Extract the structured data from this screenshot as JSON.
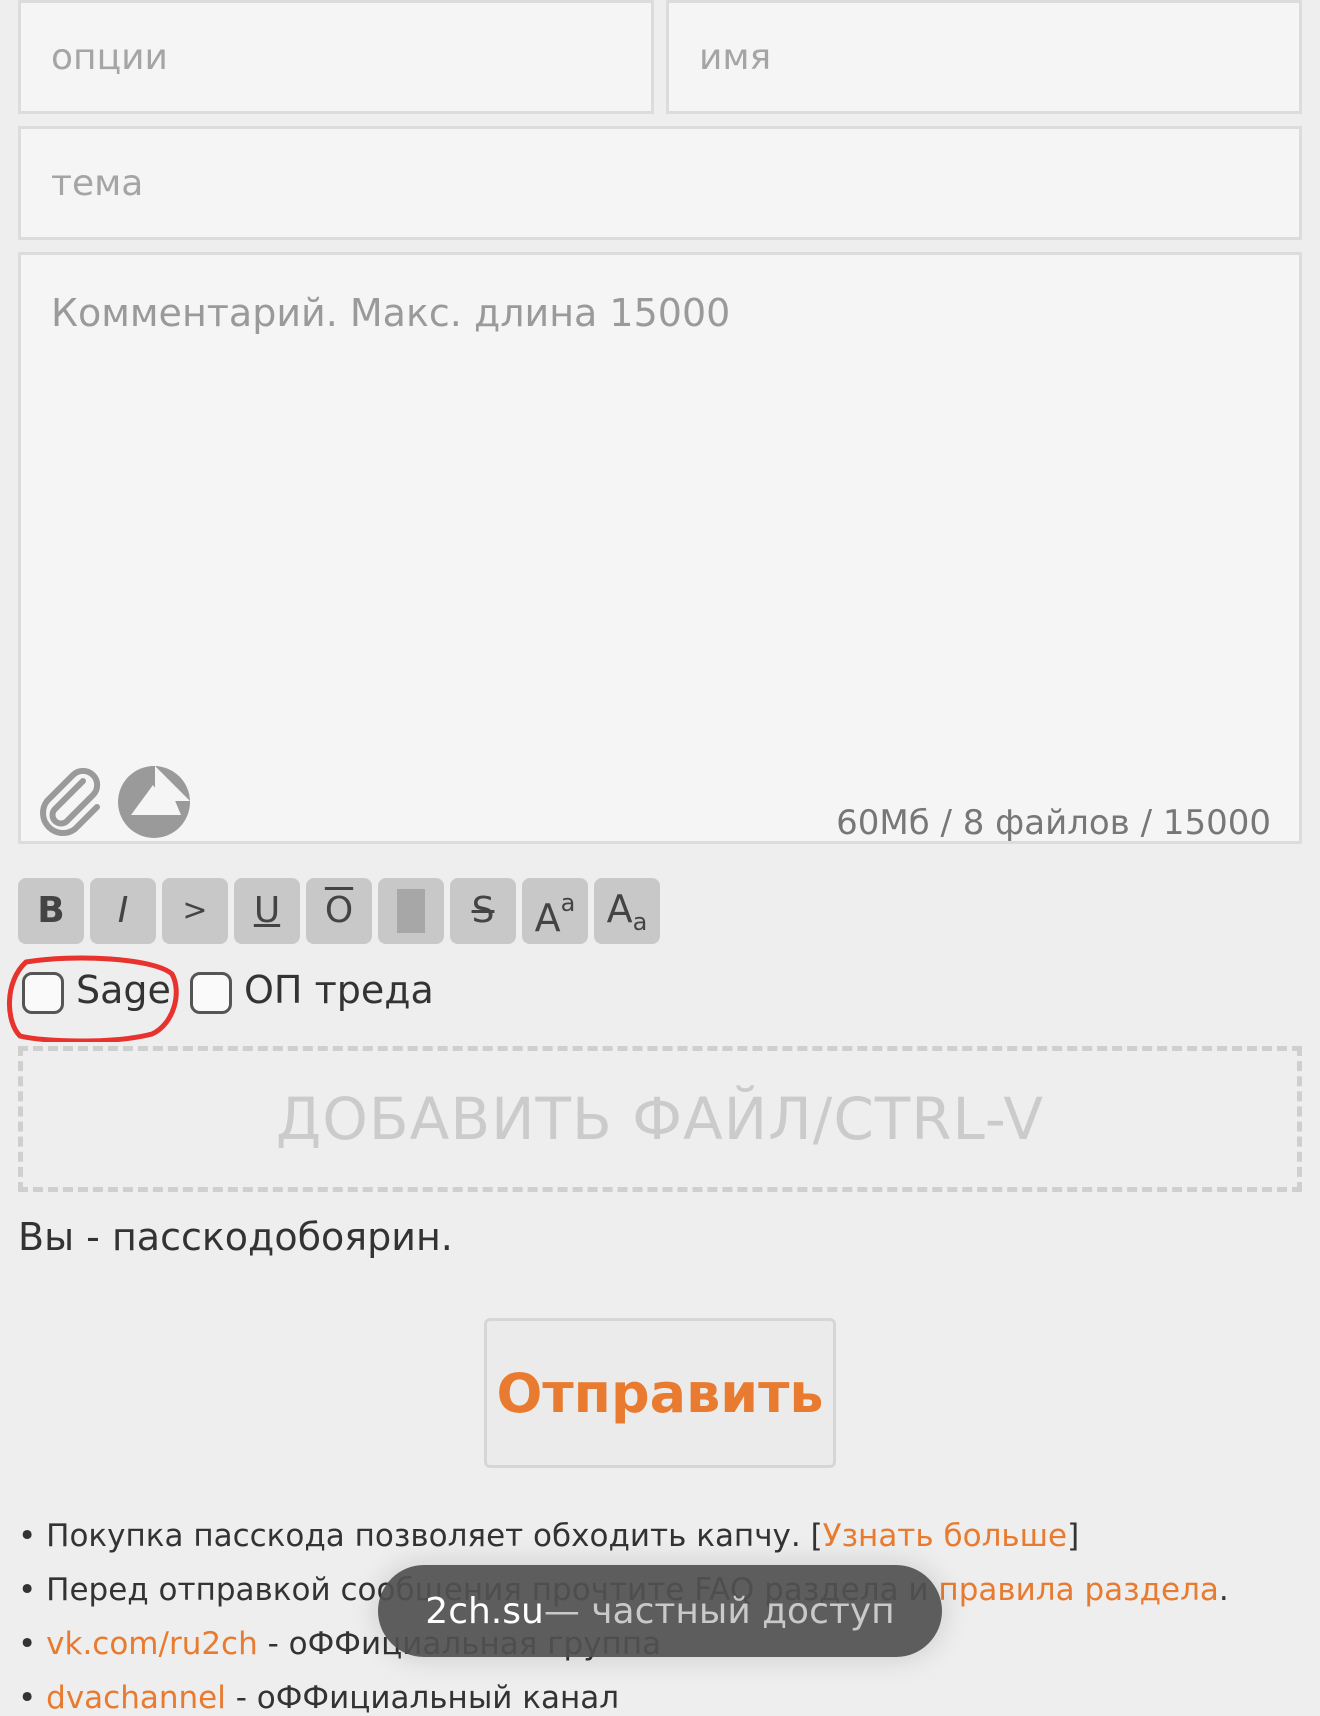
{
  "form": {
    "options_placeholder": "опции",
    "name_placeholder": "имя",
    "subject_placeholder": "тема",
    "comment_placeholder": "Комментарий. Макс. длина 15000",
    "limits": "60Мб / 8 файлов / 15000"
  },
  "toolbar": {
    "bold": "B",
    "italic": "I",
    "quote": ">",
    "underline": "U",
    "overline": "O",
    "strike": "S",
    "sup_base": "A",
    "sup_small": "a",
    "sub_base": "A",
    "sub_small": "a"
  },
  "checkboxes": {
    "sage_label": "Sage",
    "op_label": "ОП треда"
  },
  "dropzone": {
    "label": "ДОБАВИТЬ ФАЙЛ/CTRL-V"
  },
  "passcode_note": "Вы - пасскодобоярин.",
  "submit_label": "Отправить",
  "info": {
    "line1_text": "• Покупка пасскода позволяет обходить капчу. [",
    "line1_link": "Узнать больше",
    "line1_end": "]",
    "line2_text": "• Перед отправкой сообщения прочтите FAQ раздела и ",
    "line2_link": "правила раздела",
    "line2_end": ".",
    "line3_bullet": "• ",
    "line3_link": "vk.com/ru2ch",
    "line3_text": " - оФФициальная группа",
    "line4_bullet": "• ",
    "line4_link": "dvachannel",
    "line4_text": " - оФФициальный канал"
  },
  "toast": {
    "domain": "2ch.su",
    "suffix": " — частный доступ"
  },
  "colors": {
    "accent": "#e87b2f",
    "highlight": "#e8322e"
  }
}
